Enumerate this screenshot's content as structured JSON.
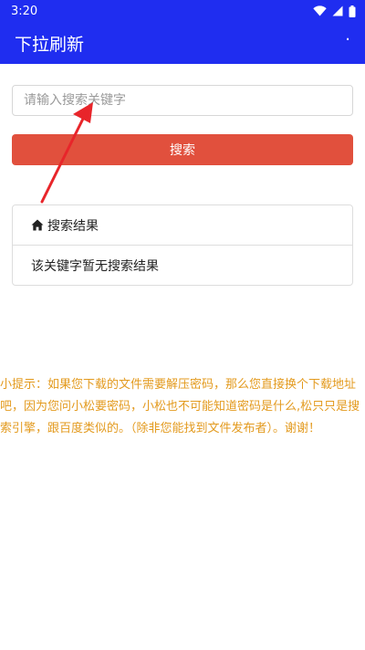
{
  "status_bar": {
    "time": "3:20",
    "icons": [
      "wifi-icon",
      "signal-icon",
      "battery-icon"
    ]
  },
  "app_bar": {
    "title": "下拉刷新",
    "menu": "·"
  },
  "search": {
    "placeholder": "请输入搜索关键字",
    "value": "",
    "button_label": "搜索"
  },
  "results": {
    "header_icon": "home-icon",
    "header": "搜索结果",
    "empty_message": "该关键字暂无搜索结果"
  },
  "tip": {
    "text": "小提示：如果您下载的文件需要解压密码，那么您直接换个下载地址吧，因为您问小松要密码，小松也不可能知道密码是什么,松只只是搜索引擎，跟百度类似的。（除非您能找到文件发布者）。谢谢！"
  },
  "colors": {
    "primary": "#1f2df0",
    "button": "#e1503d",
    "tip_text": "#e39a1e",
    "arrow": "#e8252a"
  }
}
